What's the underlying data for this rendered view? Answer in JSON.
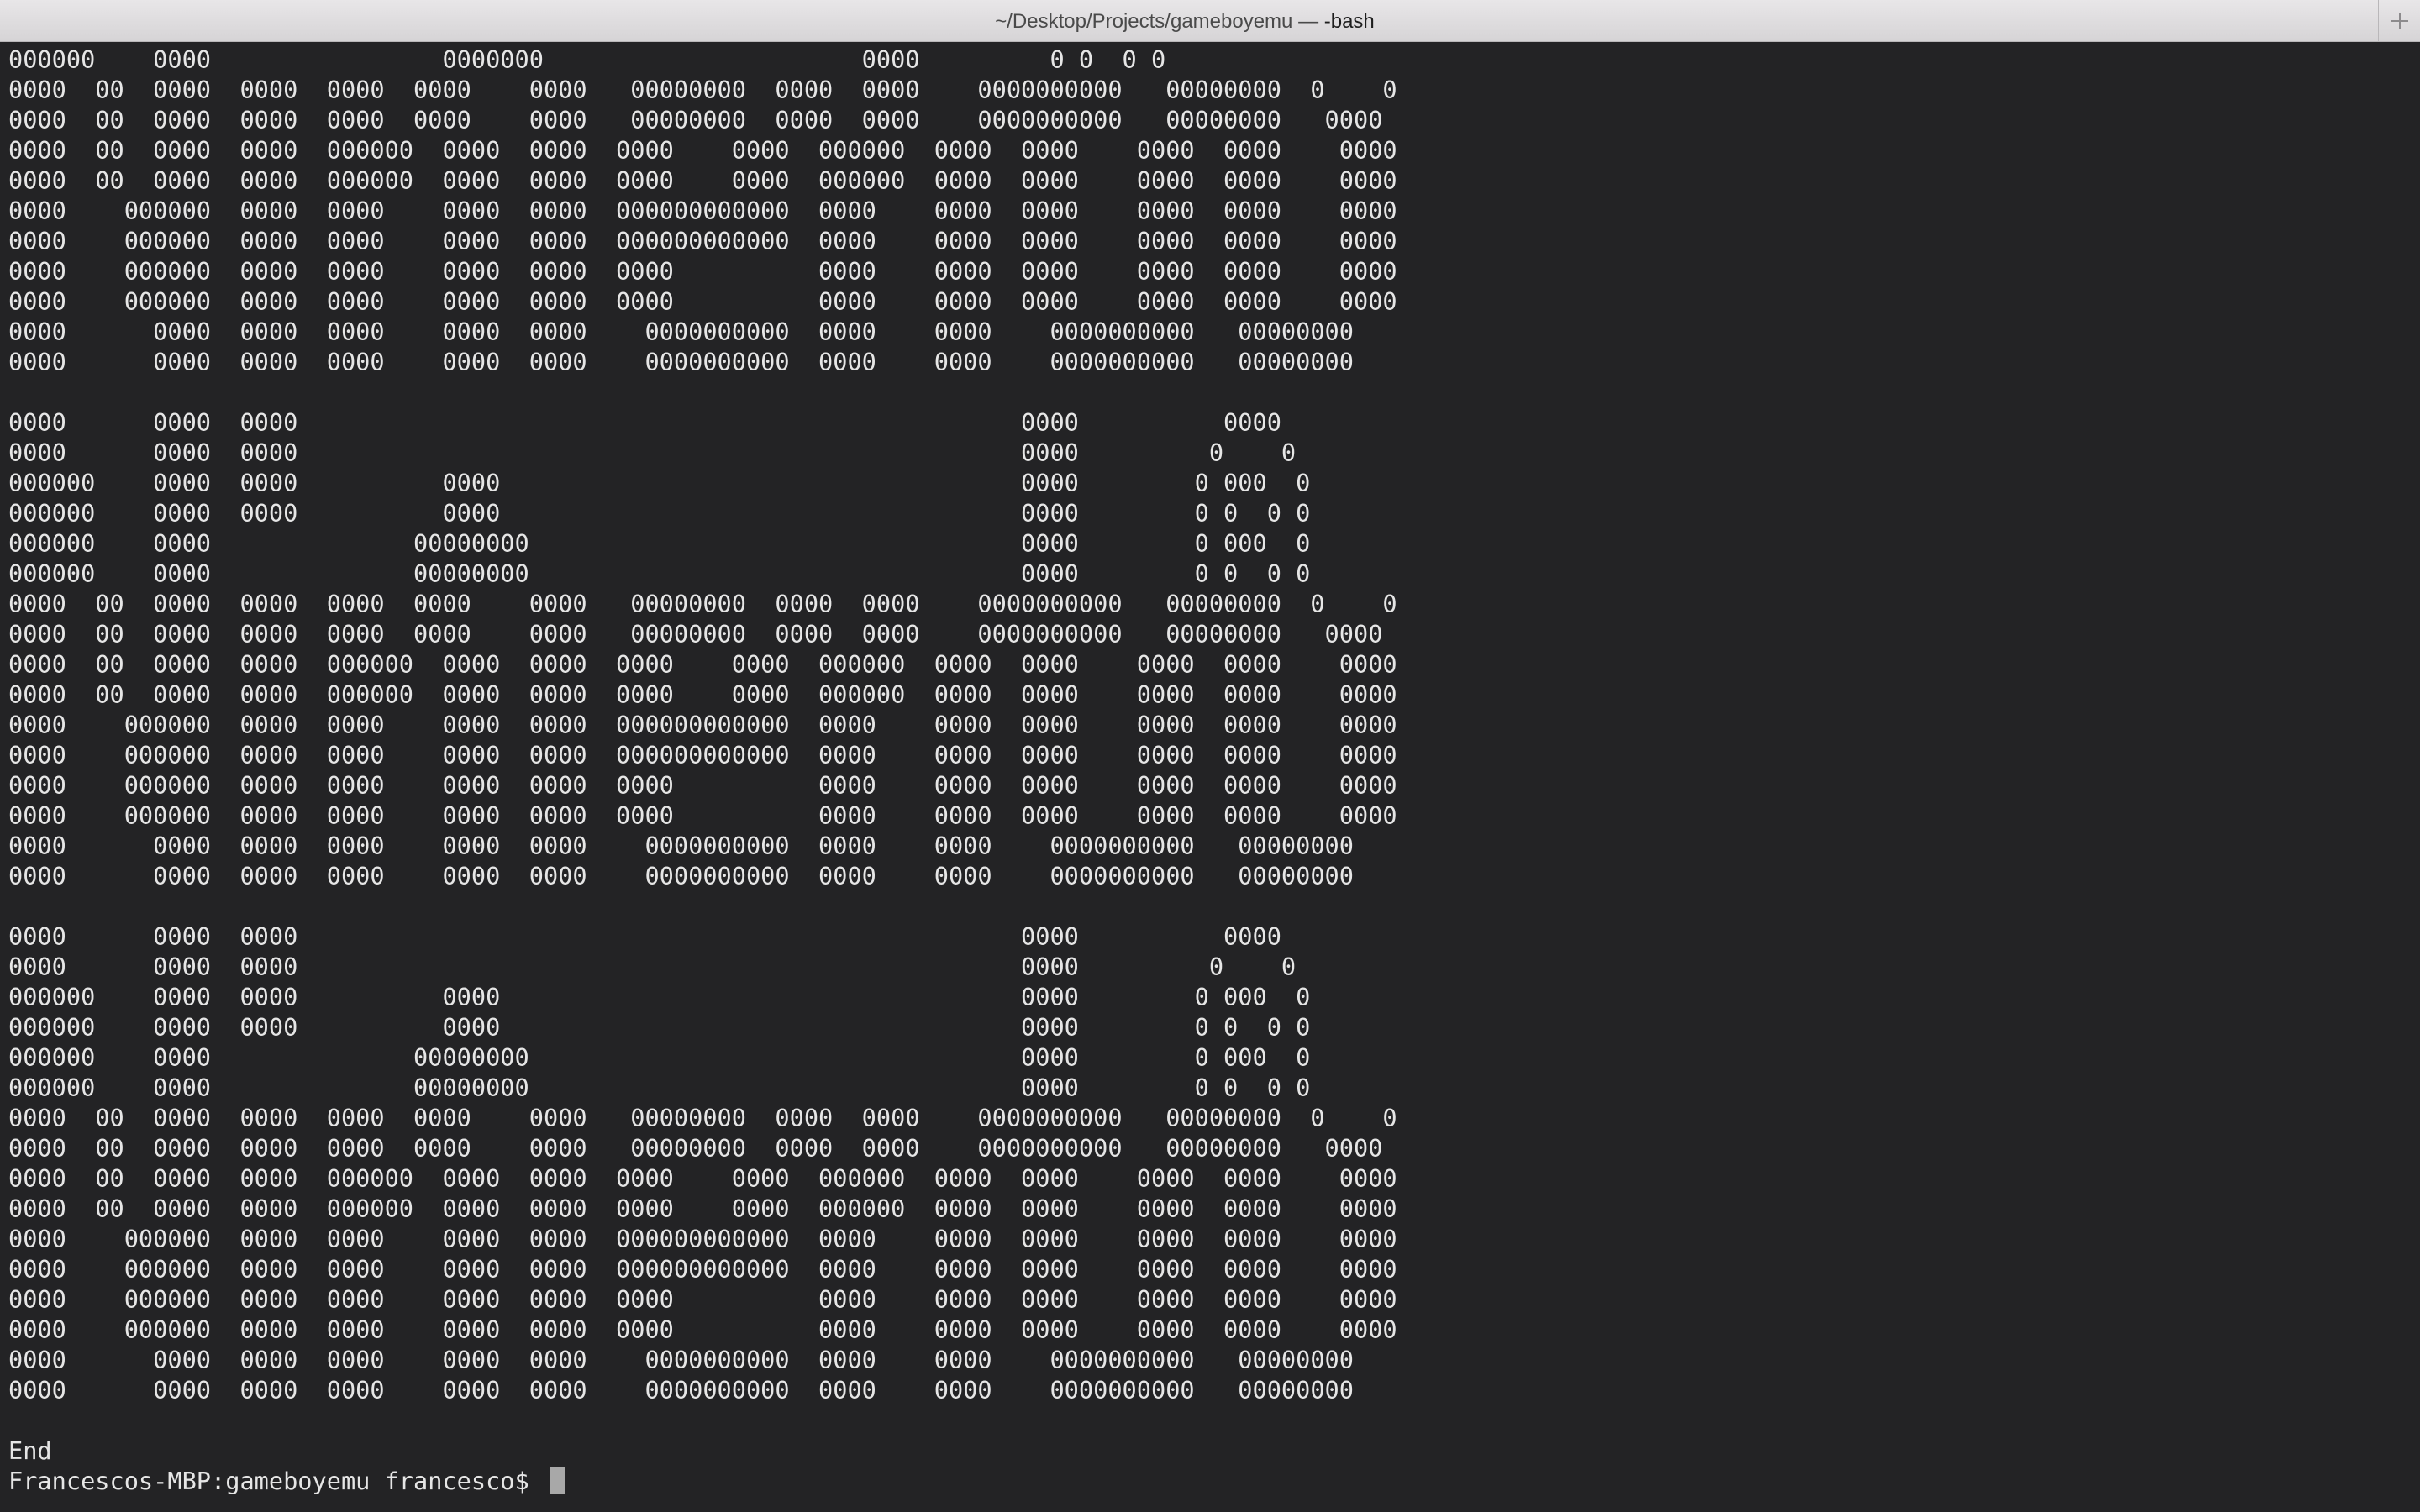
{
  "window": {
    "title": "~/Desktop/Projects/gameboyemu — ",
    "title_process": "-bash"
  },
  "terminal": {
    "output": "000000    0000                0000000                      0000         0 0  0 0\n0000  00  0000  0000  0000  0000    0000   00000000  0000  0000    0000000000   00000000  0    0\n0000  00  0000  0000  0000  0000    0000   00000000  0000  0000    0000000000   00000000   0000\n0000  00  0000  0000  000000  0000  0000  0000    0000  000000  0000  0000    0000  0000    0000\n0000  00  0000  0000  000000  0000  0000  0000    0000  000000  0000  0000    0000  0000    0000\n0000    000000  0000  0000    0000  0000  000000000000  0000    0000  0000    0000  0000    0000\n0000    000000  0000  0000    0000  0000  000000000000  0000    0000  0000    0000  0000    0000\n0000    000000  0000  0000    0000  0000  0000          0000    0000  0000    0000  0000    0000\n0000    000000  0000  0000    0000  0000  0000          0000    0000  0000    0000  0000    0000\n0000      0000  0000  0000    0000  0000    0000000000  0000    0000    0000000000   00000000\n0000      0000  0000  0000    0000  0000    0000000000  0000    0000    0000000000   00000000\n\n0000      0000  0000                                                  0000          0000\n0000      0000  0000                                                  0000         0    0\n000000    0000  0000          0000                                    0000        0 000  0\n000000    0000  0000          0000                                    0000        0 0  0 0\n000000    0000              00000000                                  0000        0 000  0\n000000    0000              00000000                                  0000        0 0  0 0\n0000  00  0000  0000  0000  0000    0000   00000000  0000  0000    0000000000   00000000  0    0\n0000  00  0000  0000  0000  0000    0000   00000000  0000  0000    0000000000   00000000   0000\n0000  00  0000  0000  000000  0000  0000  0000    0000  000000  0000  0000    0000  0000    0000\n0000  00  0000  0000  000000  0000  0000  0000    0000  000000  0000  0000    0000  0000    0000\n0000    000000  0000  0000    0000  0000  000000000000  0000    0000  0000    0000  0000    0000\n0000    000000  0000  0000    0000  0000  000000000000  0000    0000  0000    0000  0000    0000\n0000    000000  0000  0000    0000  0000  0000          0000    0000  0000    0000  0000    0000\n0000    000000  0000  0000    0000  0000  0000          0000    0000  0000    0000  0000    0000\n0000      0000  0000  0000    0000  0000    0000000000  0000    0000    0000000000   00000000\n0000      0000  0000  0000    0000  0000    0000000000  0000    0000    0000000000   00000000\n\n0000      0000  0000                                                  0000          0000\n0000      0000  0000                                                  0000         0    0\n000000    0000  0000          0000                                    0000        0 000  0\n000000    0000  0000          0000                                    0000        0 0  0 0\n000000    0000              00000000                                  0000        0 000  0\n000000    0000              00000000                                  0000        0 0  0 0\n0000  00  0000  0000  0000  0000    0000   00000000  0000  0000    0000000000   00000000  0    0\n0000  00  0000  0000  0000  0000    0000   00000000  0000  0000    0000000000   00000000   0000\n0000  00  0000  0000  000000  0000  0000  0000    0000  000000  0000  0000    0000  0000    0000\n0000  00  0000  0000  000000  0000  0000  0000    0000  000000  0000  0000    0000  0000    0000\n0000    000000  0000  0000    0000  0000  000000000000  0000    0000  0000    0000  0000    0000\n0000    000000  0000  0000    0000  0000  000000000000  0000    0000  0000    0000  0000    0000\n0000    000000  0000  0000    0000  0000  0000          0000    0000  0000    0000  0000    0000\n0000    000000  0000  0000    0000  0000  0000          0000    0000  0000    0000  0000    0000\n0000      0000  0000  0000    0000  0000    0000000000  0000    0000    0000000000   00000000\n0000      0000  0000  0000    0000  0000    0000000000  0000    0000    0000000000   00000000\n\nEnd",
    "prompt": "Francescos-MBP:gameboyemu francesco$ "
  },
  "icons": {
    "new_tab": "plus-icon",
    "cursor": "block-cursor"
  }
}
